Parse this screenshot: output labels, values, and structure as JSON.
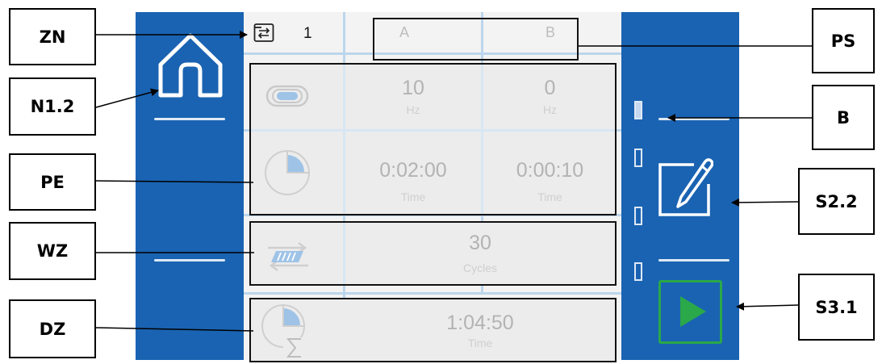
{
  "header": {
    "program_number": "1",
    "columns": [
      "A",
      "B"
    ]
  },
  "rows": {
    "frequency": {
      "a": {
        "value": "10",
        "unit": "Hz"
      },
      "b": {
        "value": "0",
        "unit": "Hz"
      }
    },
    "time": {
      "a": {
        "value": "0:02:00",
        "unit": "Time"
      },
      "b": {
        "value": "0:00:10",
        "unit": "Time"
      }
    },
    "cycles": {
      "value": "30",
      "unit": "Cycles"
    },
    "duration": {
      "value": "1:04:50",
      "unit": "Time"
    }
  },
  "callouts": {
    "zn": "ZN",
    "n12": "N1.2",
    "pe": "PE",
    "wz": "WZ",
    "dz": "DZ",
    "ps": "PS",
    "b": "B",
    "s22": "S2.2",
    "s31": "S3.1"
  },
  "icons": [
    "folder-repeat-icon",
    "home-icon",
    "frequency-icon",
    "timer-icon",
    "repeat-cycles-icon",
    "total-time-icon",
    "edit-icon",
    "play-icon"
  ],
  "colors": {
    "panel_blue": "#1a63b2",
    "content_bg": "#f3f3f3",
    "play_green": "#2aa84a",
    "grid_line": "#bcd6ec"
  }
}
